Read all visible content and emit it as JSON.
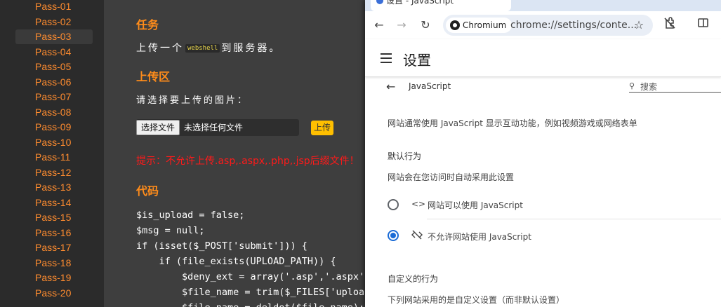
{
  "sidebar": {
    "items": [
      "Pass-01",
      "Pass-02",
      "Pass-03",
      "Pass-04",
      "Pass-05",
      "Pass-06",
      "Pass-07",
      "Pass-08",
      "Pass-09",
      "Pass-10",
      "Pass-11",
      "Pass-12",
      "Pass-13",
      "Pass-14",
      "Pass-15",
      "Pass-16",
      "Pass-17",
      "Pass-18",
      "Pass-19",
      "Pass-20"
    ],
    "active": "Pass-03"
  },
  "main": {
    "task_heading": "任务",
    "task_before": "上传一个",
    "task_code": "webshell",
    "task_after": "到服务器。",
    "upload_heading": "上传区",
    "select_prompt": "请选择要上传的图片：",
    "file_button": "选择文件",
    "file_none": "未选择任何文件",
    "upload_button": "上传",
    "hint": "提示：不允许上传.asp,.aspx,.php,.jsp后缀文件！",
    "code_heading": "代码",
    "code_lines": [
      "$is_upload = false;",
      "$msg = null;",
      "if (isset($_POST['submit'])) {",
      "    if (file_exists(UPLOAD_PATH)) {",
      "        $deny_ext = array('.asp','.aspx'",
      "        $file_name = trim($_FILES['uploa",
      "        $file_name = deldot($file_name);"
    ]
  },
  "chrome": {
    "tab_title": "设置 - JavaScript",
    "chip_label": "Chromium",
    "url": "chrome://settings/conte...",
    "settings_title": "设置",
    "page_name": "JavaScript",
    "search_placeholder": "搜索",
    "description": "网站通常使用 JavaScript 显示互动功能，例如视频游戏或网络表单",
    "default_heading": "默认行为",
    "default_sub": "网站会在您访问时自动采用此设置",
    "option_allow": "网站可以使用 JavaScript",
    "option_block": "不允许网站使用 JavaScript",
    "selected_option": "block",
    "custom_heading": "自定义的行为",
    "custom_sub": "下列网站采用的是自定义设置（而非默认设置）",
    "accent_color": "#1a6bd6"
  }
}
